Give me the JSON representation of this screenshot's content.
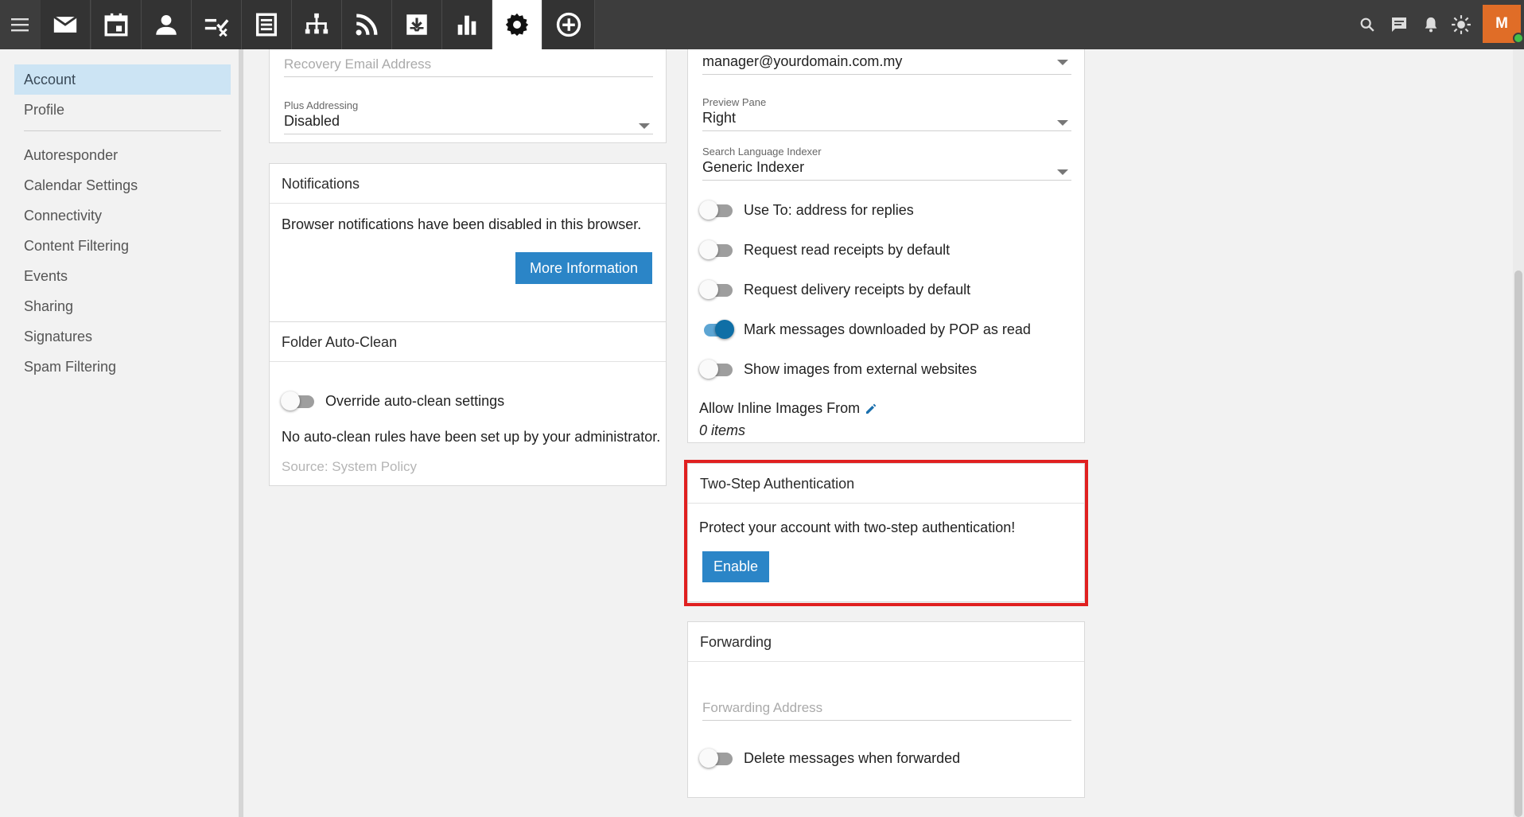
{
  "topbar": {
    "menu_icon": "hamburger-icon",
    "tabs": [
      {
        "name": "mail",
        "icon": "mail-icon"
      },
      {
        "name": "calendar",
        "icon": "calendar-icon"
      },
      {
        "name": "contacts",
        "icon": "person-icon"
      },
      {
        "name": "tasks",
        "icon": "tasks-icon"
      },
      {
        "name": "notes",
        "icon": "notes-icon"
      },
      {
        "name": "organization",
        "icon": "org-chart-icon"
      },
      {
        "name": "rss",
        "icon": "rss-icon"
      },
      {
        "name": "archive",
        "icon": "archive-icon"
      },
      {
        "name": "reports",
        "icon": "bar-chart-icon"
      },
      {
        "name": "settings",
        "icon": "gear-icon",
        "active": true
      },
      {
        "name": "add",
        "icon": "add-circle-icon"
      }
    ],
    "right_icons": [
      "search-icon",
      "chat-icon",
      "bell-icon",
      "brightness-icon"
    ],
    "avatar_letter": "M",
    "avatar_color": "#e06d27",
    "status_color": "#45c148"
  },
  "sidebar": {
    "items": [
      {
        "label": "Account",
        "active": true
      },
      {
        "label": "Profile"
      },
      {
        "label": "Autoresponder"
      },
      {
        "label": "Calendar Settings"
      },
      {
        "label": "Connectivity"
      },
      {
        "label": "Content Filtering"
      },
      {
        "label": "Events"
      },
      {
        "label": "Sharing"
      },
      {
        "label": "Signatures"
      },
      {
        "label": "Spam Filtering"
      }
    ]
  },
  "left_column": {
    "recovery_email": {
      "placeholder": "Recovery Email Address"
    },
    "plus_addressing": {
      "label": "Plus Addressing",
      "value": "Disabled"
    },
    "notifications": {
      "title": "Notifications",
      "message": "Browser notifications have been disabled in this browser.",
      "button": "More Information"
    },
    "folder_auto_clean": {
      "title": "Folder Auto-Clean",
      "toggle_label": "Override auto-clean settings",
      "toggle_on": false,
      "message": "No auto-clean rules have been set up by your administrator.",
      "source": "Source: System Policy"
    }
  },
  "right_column": {
    "email_select": {
      "value": "manager@yourdomain.com.my"
    },
    "preview_pane": {
      "label": "Preview Pane",
      "value": "Right"
    },
    "search_indexer": {
      "label": "Search Language Indexer",
      "value": "Generic Indexer"
    },
    "toggles": [
      {
        "label": "Use To: address for replies",
        "on": false
      },
      {
        "label": "Request read receipts by default",
        "on": false
      },
      {
        "label": "Request delivery receipts by default",
        "on": false
      },
      {
        "label": "Mark messages downloaded by POP as read",
        "on": true
      },
      {
        "label": "Show images from external websites",
        "on": false
      }
    ],
    "inline_images": {
      "label": "Allow Inline Images From",
      "count": "0 items"
    },
    "two_step": {
      "title": "Two-Step Authentication",
      "message": "Protect your account with two-step authentication!",
      "button": "Enable"
    },
    "forwarding": {
      "title": "Forwarding",
      "placeholder": "Forwarding Address",
      "toggle_label": "Delete messages when forwarded",
      "toggle_on": false
    }
  },
  "colors": {
    "accent": "#2b85c7",
    "highlight": "#e02020",
    "sidebar_active": "#cce4f4"
  }
}
